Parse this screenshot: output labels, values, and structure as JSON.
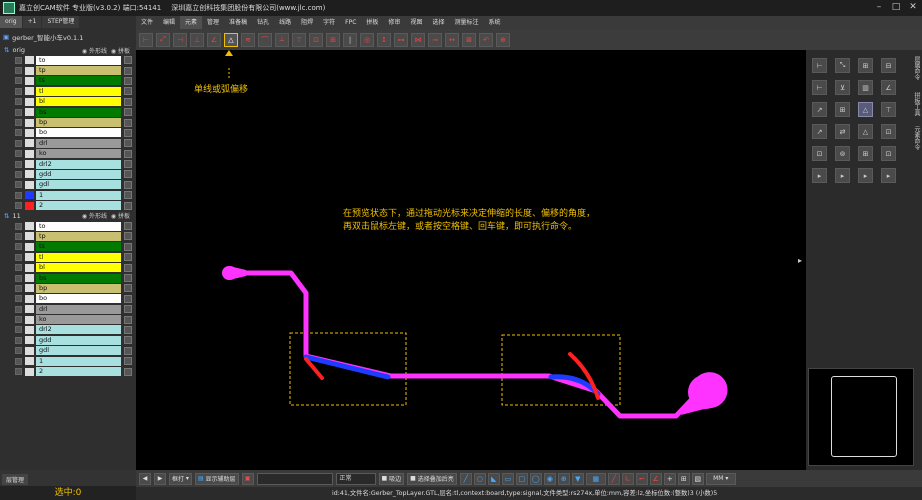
{
  "window": {
    "title": "嘉立创CAM软件 专业版(v3.0.2) 端口:54141",
    "company": "深圳嘉立创科技集团股份有限公司(www.jlc.com)",
    "controls": [
      "–",
      "□",
      "✕"
    ]
  },
  "menu": [
    "文件",
    "编辑",
    "元素",
    "管理",
    "准备稿",
    "钻孔",
    "线路",
    "阻焊",
    "字符",
    "FPC",
    "拼板",
    "修审",
    "视图",
    "选择",
    "测量标注",
    "系统"
  ],
  "menu_active": "元素",
  "left_panel": {
    "tabs": [
      "orig",
      "+1",
      "STEP管理"
    ],
    "job_name": "gerber_智能小车v0.1.1",
    "steps": [
      {
        "name": "orig",
        "opt1": "外形线",
        "opt2": "拼板",
        "layers": [
          {
            "name": "to",
            "color": "#ffffff",
            "swatch": "#dddddd"
          },
          {
            "name": "tp",
            "color": "#c8c070",
            "swatch": "#dddddd"
          },
          {
            "name": "ts",
            "color": "#007a00",
            "swatch": "#dddddd"
          },
          {
            "name": "tl",
            "color": "#ffff00",
            "swatch": "#dddddd"
          },
          {
            "name": "bl",
            "color": "#ffff00",
            "swatch": "#dddddd"
          },
          {
            "name": "bs",
            "color": "#007a00",
            "swatch": "#dddddd"
          },
          {
            "name": "bp",
            "color": "#c8c070",
            "swatch": "#dddddd"
          },
          {
            "name": "bo",
            "color": "#ffffff",
            "swatch": "#dddddd"
          },
          {
            "name": "drl",
            "color": "#9a9a9a",
            "swatch": "#dddddd"
          },
          {
            "name": "ko",
            "color": "#9a9a9a",
            "swatch": "#dddddd"
          },
          {
            "name": "drl2",
            "color": "#a8e0e0",
            "swatch": "#dddddd"
          },
          {
            "name": "gdd",
            "color": "#a8e0e0",
            "swatch": "#dddddd"
          },
          {
            "name": "gdl",
            "color": "#a8e0e0",
            "swatch": "#dddddd"
          },
          {
            "name": "1",
            "color": "#a8e0e0",
            "swatch": "#1e3cff"
          },
          {
            "name": "2",
            "color": "#a8e0e0",
            "swatch": "#ff2020"
          }
        ]
      },
      {
        "name": "11",
        "opt1": "外形线",
        "opt2": "拼板",
        "layers": [
          {
            "name": "to",
            "color": "#ffffff",
            "swatch": "#dddddd"
          },
          {
            "name": "tp",
            "color": "#c8c070",
            "swatch": "#dddddd"
          },
          {
            "name": "ts",
            "color": "#007a00",
            "swatch": "#dddddd"
          },
          {
            "name": "tl",
            "color": "#ffff00",
            "swatch": "#dddddd"
          },
          {
            "name": "bl",
            "color": "#ffff00",
            "swatch": "#dddddd"
          },
          {
            "name": "bs",
            "color": "#007a00",
            "swatch": "#dddddd"
          },
          {
            "name": "bp",
            "color": "#c8c070",
            "swatch": "#dddddd"
          },
          {
            "name": "bo",
            "color": "#ffffff",
            "swatch": "#dddddd"
          },
          {
            "name": "drl",
            "color": "#9a9a9a",
            "swatch": "#dddddd"
          },
          {
            "name": "ko",
            "color": "#9a9a9a",
            "swatch": "#dddddd"
          },
          {
            "name": "drl2",
            "color": "#a8e0e0",
            "swatch": "#dddddd"
          },
          {
            "name": "gdd",
            "color": "#a8e0e0",
            "swatch": "#dddddd"
          },
          {
            "name": "gdl",
            "color": "#a8e0e0",
            "swatch": "#dddddd"
          },
          {
            "name": "1",
            "color": "#a8e0e0",
            "swatch": "#dddddd"
          },
          {
            "name": "2",
            "color": "#a8e0e0",
            "swatch": "#dddddd"
          }
        ]
      }
    ],
    "bottom_tab": "层管理",
    "selected_count": "选中:0"
  },
  "canvas": {
    "annotation_tool": "单线或弧偏移",
    "annotation_line1": "在预览状态下，通过拖动光标来决定伸缩的长度、偏移的角度，",
    "annotation_line2": "再双击鼠标左键，或者按空格键、回车键，即可执行命令。",
    "colors": {
      "trace": "#ff33ff",
      "preview_blue": "#1e3cff",
      "preview_red": "#ff2020",
      "dash_box": "#f0c000"
    }
  },
  "right_panel": {
    "vertical_tabs": [
      "层属命令",
      "拼板工具",
      "元素命令"
    ]
  },
  "bottom_bar": {
    "mode": "框打",
    "show_button": "显示辅助层",
    "style_select": "正常",
    "option1": "吸边",
    "option2": "选择叠加后亮",
    "unit": "MM"
  },
  "status": "id:41,文件名:Gerber_TopLayer.GTL,层名:tl,context:board,type:signal,文件类型:rs274x,单位:mm,容差:lz,坐标位数:(整数)3 (小数)5"
}
